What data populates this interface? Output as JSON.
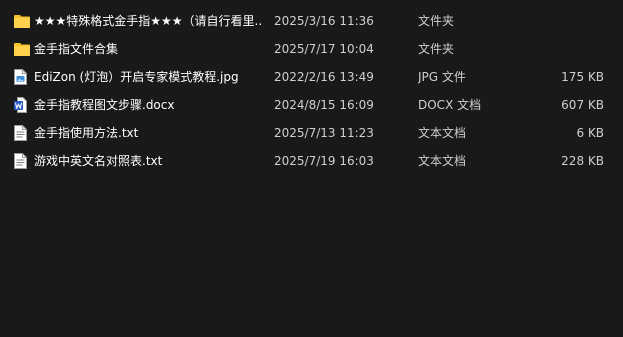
{
  "files": [
    {
      "name": "★★★特殊格式金手指★★★（请自行看里...",
      "date": "2025/3/16 11:36",
      "type": "文件夹",
      "size": "",
      "icon": "folder-icon"
    },
    {
      "name": "金手指文件合集",
      "date": "2025/7/17 10:04",
      "type": "文件夹",
      "size": "",
      "icon": "folder-icon"
    },
    {
      "name": "EdiZon (灯泡）开启专家模式教程.jpg",
      "date": "2022/2/16 13:49",
      "type": "JPG 文件",
      "size": "175 KB",
      "icon": "image-file-icon"
    },
    {
      "name": "金手指教程图文步骤.docx",
      "date": "2024/8/15 16:09",
      "type": "DOCX 文档",
      "size": "607 KB",
      "icon": "word-document-icon"
    },
    {
      "name": "金手指使用方法.txt",
      "date": "2025/7/13 11:23",
      "type": "文本文档",
      "size": "6 KB",
      "icon": "text-file-icon"
    },
    {
      "name": "游戏中英文名对照表.txt",
      "date": "2025/7/19 16:03",
      "type": "文本文档",
      "size": "228 KB",
      "icon": "text-file-icon"
    }
  ],
  "colors": {
    "background": "#191919",
    "folder": "#f5c02a",
    "word_blue": "#2b5cc4",
    "image_blue": "#3b8fd9"
  }
}
